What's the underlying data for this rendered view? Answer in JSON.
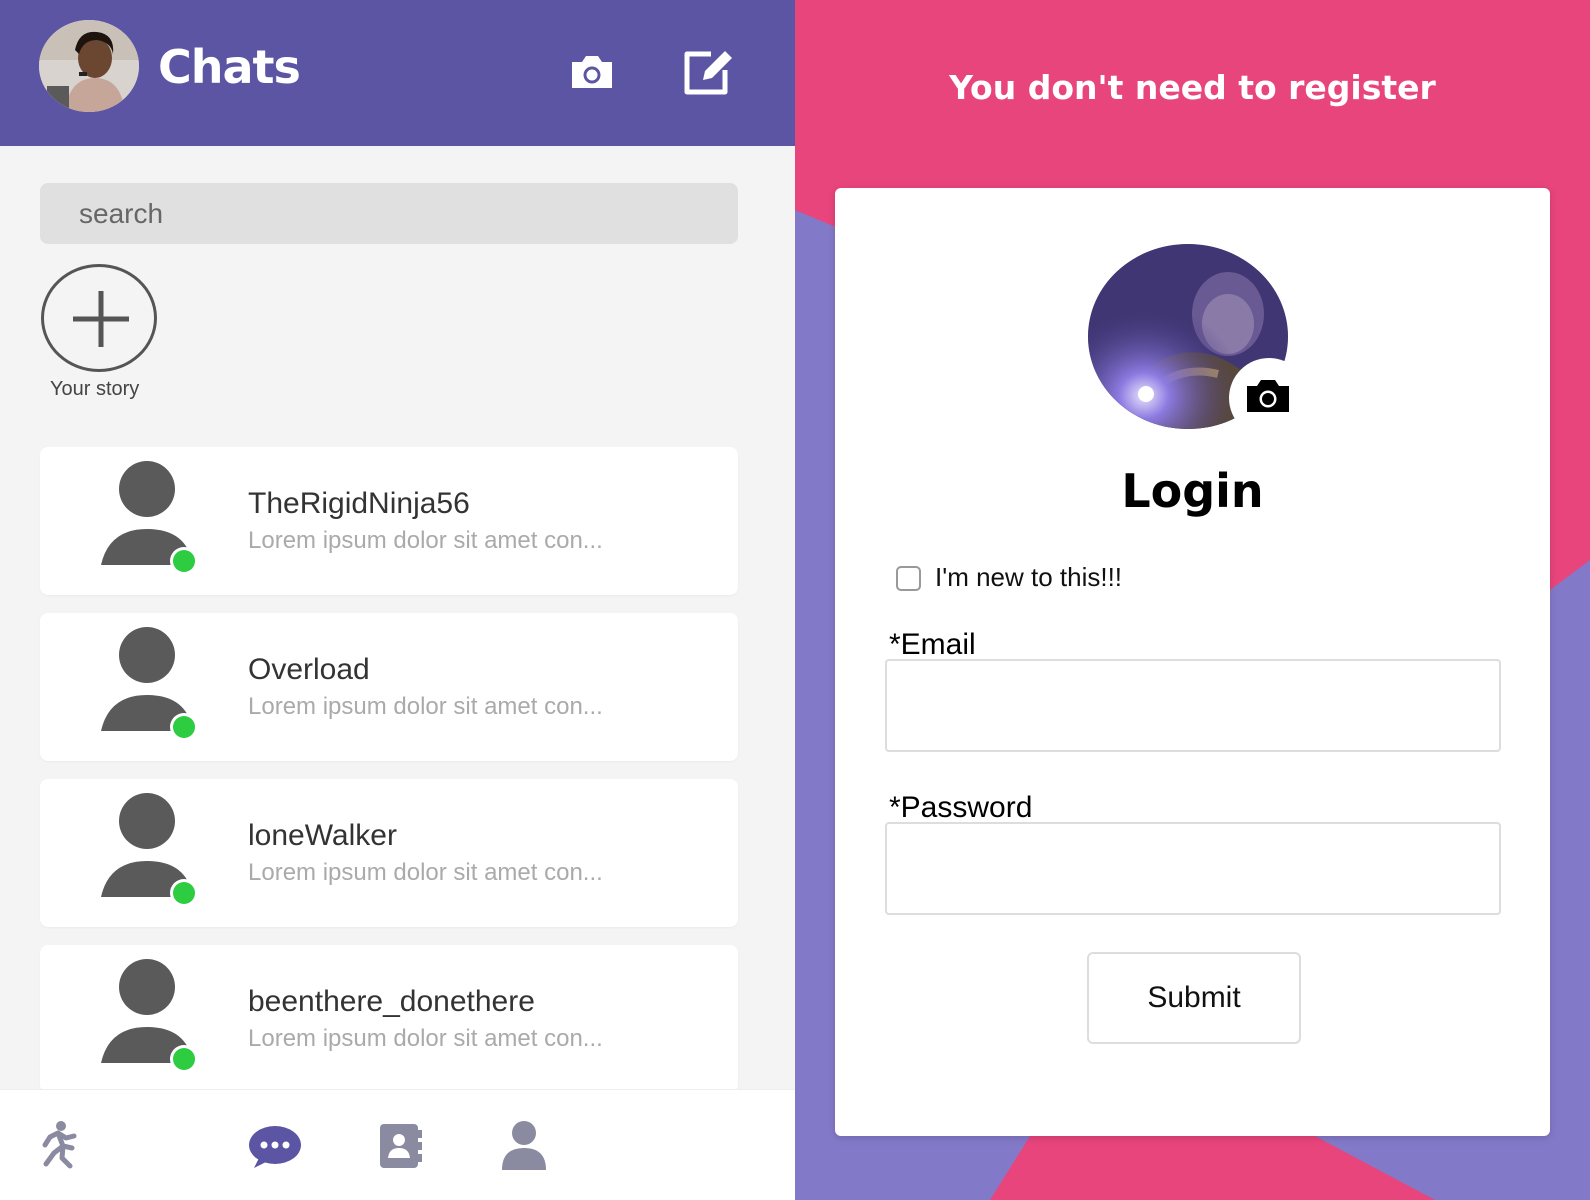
{
  "chats_panel": {
    "header": {
      "title": "Chats",
      "bg_color": "#5b55a3",
      "actions": [
        {
          "icon": "camera-icon"
        },
        {
          "icon": "compose-icon"
        }
      ]
    },
    "search": {
      "placeholder": "search",
      "value": ""
    },
    "story": {
      "label": "Your story",
      "icon": "plus-icon"
    },
    "chats": [
      {
        "name": "TheRigidNinja56",
        "preview": "Lorem ipsum dolor sit amet con...",
        "online": true
      },
      {
        "name": "Overload",
        "preview": "Lorem ipsum dolor sit amet con...",
        "online": true
      },
      {
        "name": "loneWalker",
        "preview": "Lorem ipsum dolor sit amet con...",
        "online": true
      },
      {
        "name": "beenthere_donethere",
        "preview": "Lorem ipsum dolor sit amet con...",
        "online": true
      }
    ],
    "bottom_nav": [
      {
        "icon": "running-person-icon"
      },
      {
        "icon": "chat-bubble-icon",
        "active": true
      },
      {
        "icon": "contacts-book-icon"
      },
      {
        "icon": "user-profile-icon"
      }
    ]
  },
  "login_panel": {
    "banner": "You don't need to register",
    "title": "Login",
    "new_user_checkbox": {
      "label": "I'm new to this!!!",
      "checked": false
    },
    "email": {
      "label": "*Email",
      "value": ""
    },
    "password": {
      "label": "*Password",
      "value": ""
    },
    "submit_label": "Submit",
    "colors": {
      "pink": "#e8457c",
      "purple": "#8379c9",
      "accent": "#5b55a3",
      "online": "#2ecc40"
    }
  }
}
